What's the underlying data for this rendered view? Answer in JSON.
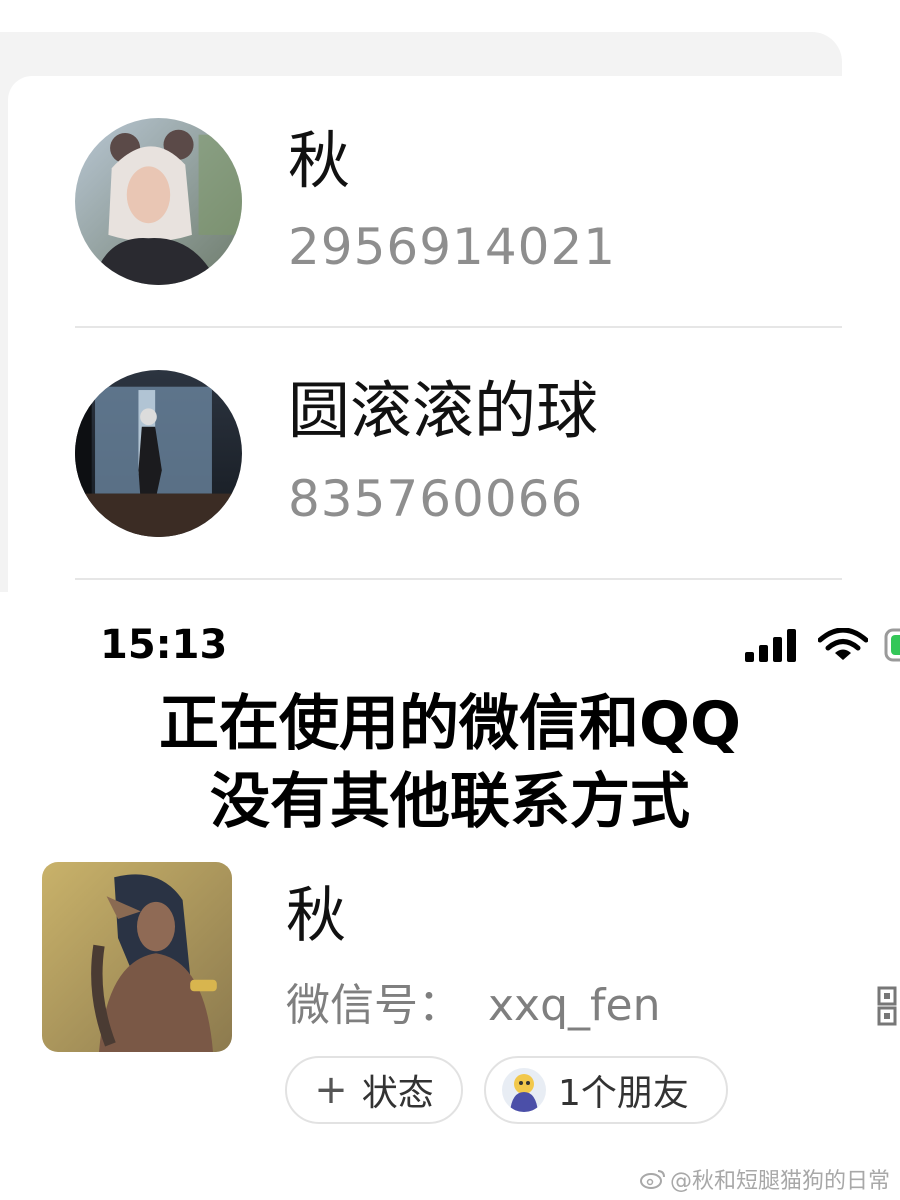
{
  "qq_contacts": [
    {
      "name": "秋",
      "number": "2956914021"
    },
    {
      "name": "圆滚滚的球",
      "number": "835760066"
    }
  ],
  "status_bar": {
    "time": "15:13"
  },
  "caption": {
    "line1": "正在使用的微信和QQ",
    "line2": "没有其他联系方式"
  },
  "wechat_profile": {
    "name": "秋",
    "id_label": "微信号：",
    "id_value": "xxq_fen",
    "status_button": "状态",
    "status_icon": "plus-icon",
    "friends_button": "1个朋友"
  },
  "watermark": "@秋和短腿猫狗的日常",
  "colors": {
    "secondary_text": "#8e8e8e",
    "divider": "#e6e6e6",
    "battery_green": "#34c759"
  }
}
